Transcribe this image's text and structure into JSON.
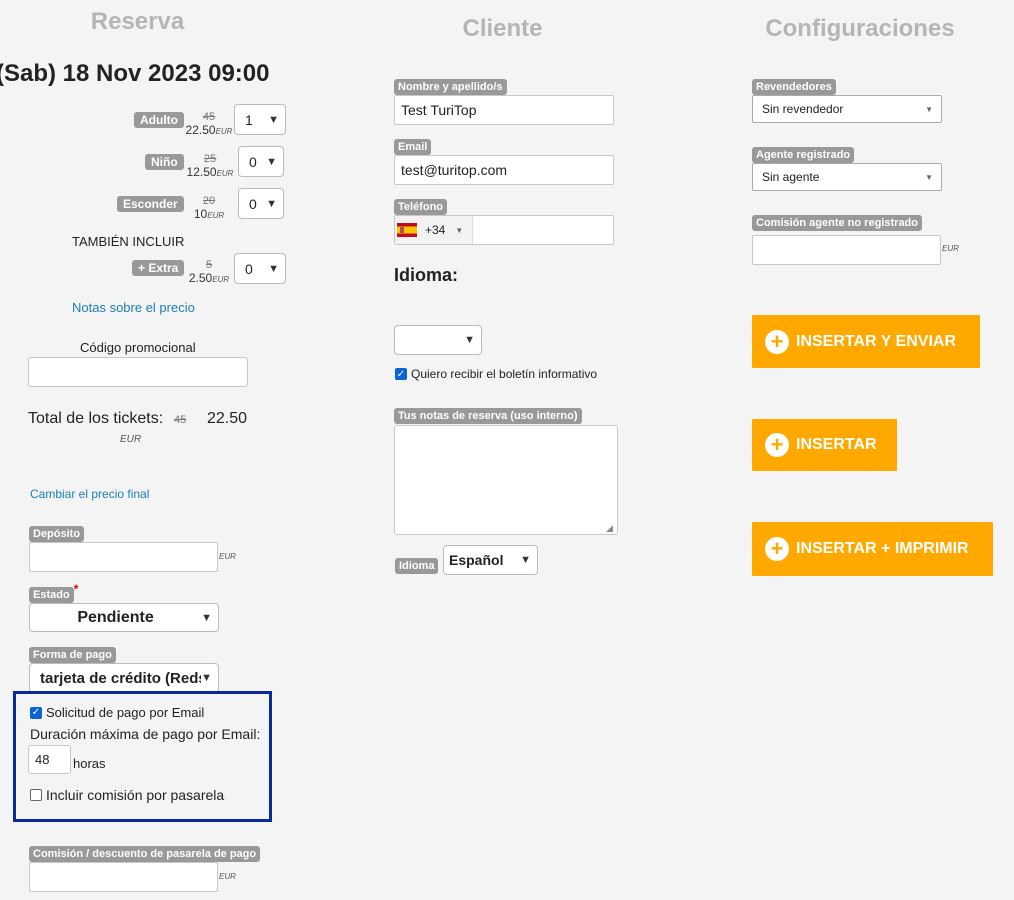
{
  "columns": {
    "reserva": "Reserva",
    "cliente": "Cliente",
    "config": "Configuraciones"
  },
  "booking": {
    "date": "(Sab) 18 Nov 2023 09:00",
    "tickets": [
      {
        "label": "Adulto",
        "old_price": "45",
        "price": "22.50",
        "qty": "1"
      },
      {
        "label": "Niño",
        "old_price": "25",
        "price": "12.50",
        "qty": "0"
      },
      {
        "label": "Esconder",
        "old_price": "20",
        "price": "10",
        "qty": "0"
      }
    ],
    "also_include": "TAMBIÉN INCLUIR",
    "extra": {
      "label": "+ Extra",
      "old_price": "5",
      "price": "2.50",
      "qty": "0"
    },
    "currency": "EUR",
    "price_notes_link": "Notas sobre el precio",
    "promo_label": "Código promocional",
    "promo_value": "",
    "total_label": "Total de los tickets:",
    "total_old": "45",
    "total_value": "22.50",
    "change_price_link": "Cambiar el precio final",
    "deposit_label": "Depósito",
    "deposit_value": "",
    "status_label": "Estado",
    "status_required": "*",
    "status_value": "Pendiente",
    "payment_label": "Forma de pago",
    "payment_value": "tarjeta de crédito (Reds",
    "email_payment_label": "Solicitud de pago por Email",
    "email_payment_checked": true,
    "max_duration_label": "Duración máxima de pago por Email:",
    "max_duration_value": "48",
    "hours_label": "horas",
    "gateway_fee_label": "Incluir comisión por pasarela",
    "gateway_fee_checked": false,
    "gateway_discount_label": "Comisión / descuento de pasarela de pago",
    "gateway_discount_value": ""
  },
  "client": {
    "name_label": "Nombre y apellido/s",
    "name_value": "Test TuriTop",
    "email_label": "Email",
    "email_value": "test@turitop.com",
    "phone_label": "Teléfono",
    "phone_prefix": "+34",
    "phone_value": "",
    "language_heading": "Idioma:",
    "language_value": "",
    "newsletter_label": "Quiero recibir el boletín informativo",
    "newsletter_checked": true,
    "notes_label": "Tus notas de reserva (uso interno)",
    "notes_value": "",
    "lang_tag": "Idioma",
    "lang_select": "Español"
  },
  "config": {
    "resellers_label": "Revendedores",
    "resellers_value": "Sin revendedor",
    "agent_label": "Agente registrado",
    "agent_value": "Sin agente",
    "commission_label": "Comisión agente no registrado",
    "commission_value": "",
    "buttons": {
      "insert_send": "INSERTAR Y ENVIAR",
      "insert": "INSERTAR",
      "insert_print": "INSERTAR + IMPRIMIR"
    }
  },
  "colors": {
    "accent": "#ffa800",
    "tag": "#999999",
    "link": "#1a7fbf",
    "highlight_border": "#0a2a9c"
  }
}
